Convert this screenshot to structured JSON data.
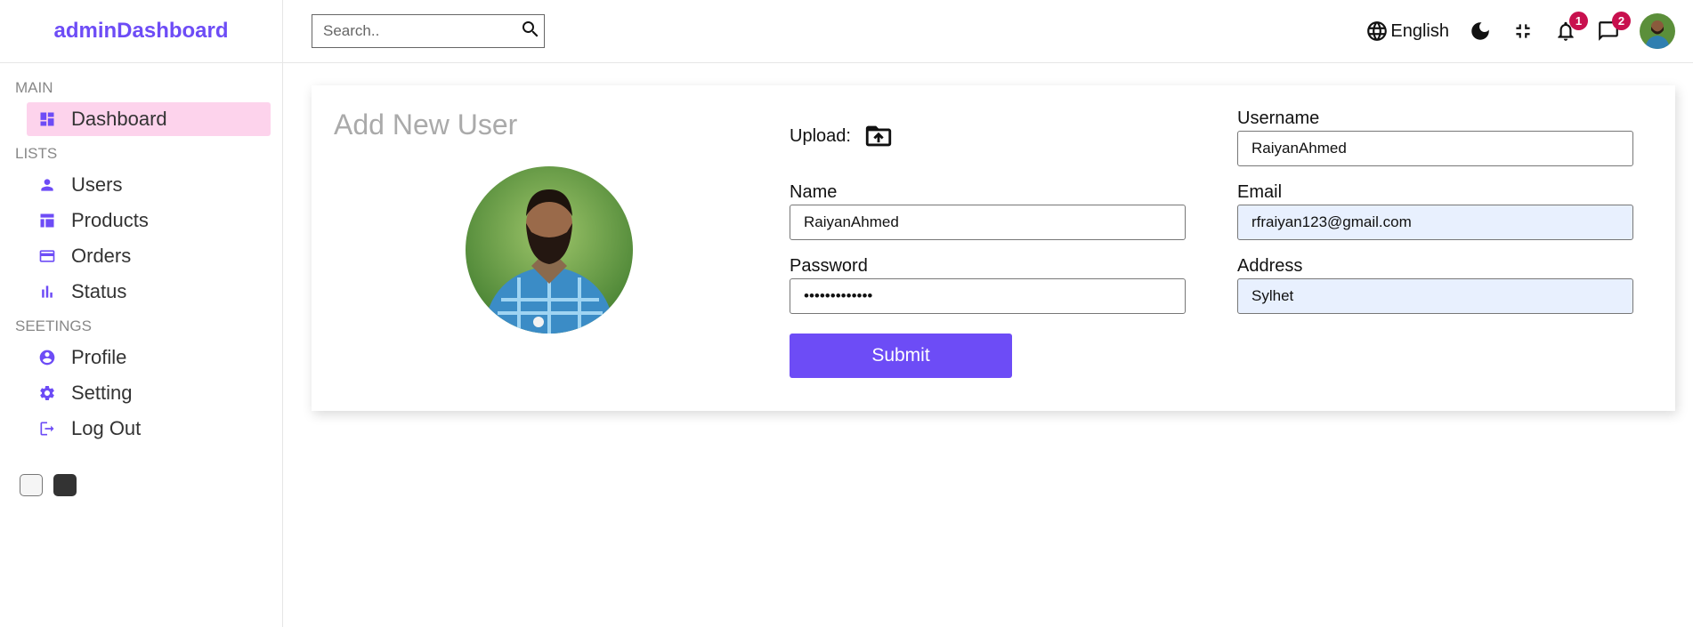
{
  "logo": "adminDashboard",
  "sidebar": {
    "sections": [
      {
        "title": "MAIN",
        "items": [
          {
            "label": "Dashboard",
            "icon": "dashboard-icon",
            "active": true
          }
        ]
      },
      {
        "title": "LISTS",
        "items": [
          {
            "label": "Users",
            "icon": "person-icon"
          },
          {
            "label": "Products",
            "icon": "table-icon"
          },
          {
            "label": "Orders",
            "icon": "credit-card-icon"
          },
          {
            "label": "Status",
            "icon": "bar-chart-icon"
          }
        ]
      },
      {
        "title": "SEETINGS",
        "items": [
          {
            "label": "Profile",
            "icon": "account-circle-icon"
          },
          {
            "label": "Setting",
            "icon": "gear-icon"
          },
          {
            "label": "Log Out",
            "icon": "logout-icon"
          }
        ]
      }
    ],
    "themes": [
      "light",
      "dark"
    ]
  },
  "topbar": {
    "search_placeholder": "Search..",
    "language": "English",
    "notifications_count": "1",
    "messages_count": "2"
  },
  "form": {
    "title": "Add New User",
    "upload_label": "Upload:",
    "fields": {
      "username": {
        "label": "Username",
        "value": "RaiyanAhmed"
      },
      "name": {
        "label": "Name",
        "value": "RaiyanAhmed"
      },
      "email": {
        "label": "Email",
        "value": "rfraiyan123@gmail.com"
      },
      "password": {
        "label": "Password",
        "value": "password12345"
      },
      "address": {
        "label": "Address",
        "value": "Sylhet"
      }
    },
    "submit_label": "Submit"
  },
  "colors": {
    "accent": "#6d4cf6",
    "active_bg": "#fdd3ec",
    "badge": "#c8104e",
    "autofill": "#e8f0fe"
  }
}
